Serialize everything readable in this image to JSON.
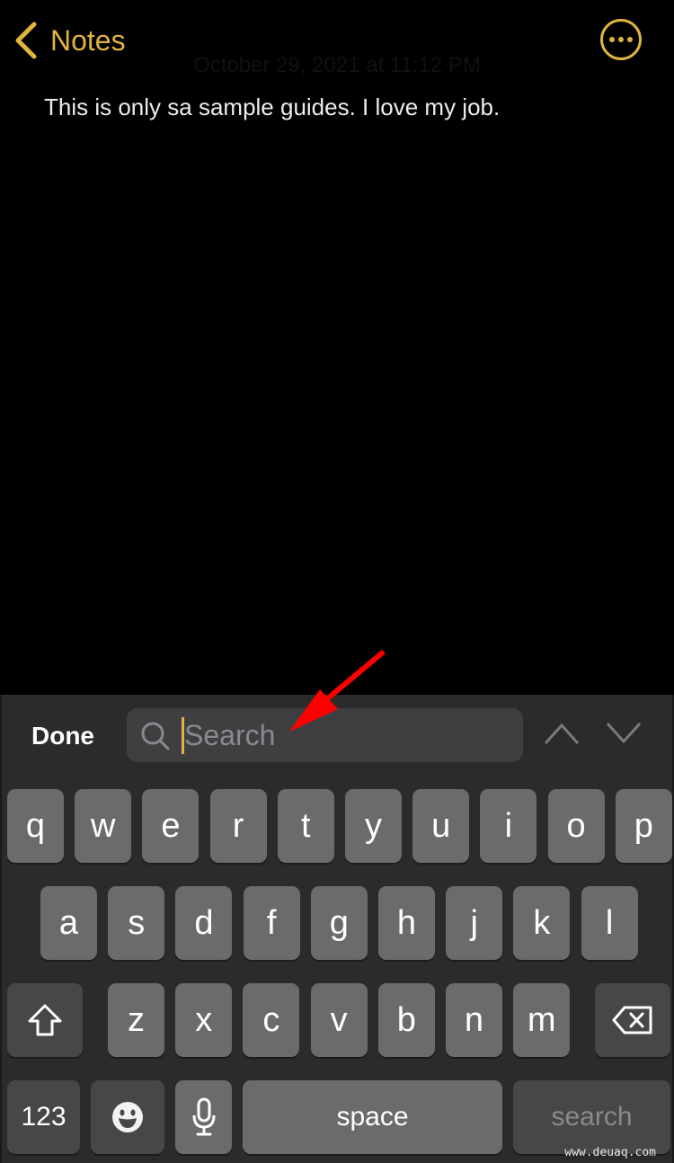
{
  "nav": {
    "back_label": "Notes",
    "back_icon": "chevron-left-icon",
    "more_icon": "ellipsis-circle-icon",
    "accent_color": "#E1B43F"
  },
  "note": {
    "date": "October 29, 2021 at 11:12 PM",
    "body": "This is only sa sample guides. I love my job."
  },
  "find_bar": {
    "done_label": "Done",
    "search_placeholder": "Search",
    "search_value": "",
    "search_icon": "magnifier-icon",
    "prev_icon": "chevron-up-icon",
    "next_icon": "chevron-down-icon"
  },
  "keyboard": {
    "row1": [
      "q",
      "w",
      "e",
      "r",
      "t",
      "y",
      "u",
      "i",
      "o",
      "p"
    ],
    "row2": [
      "a",
      "s",
      "d",
      "f",
      "g",
      "h",
      "j",
      "k",
      "l"
    ],
    "row3": [
      "z",
      "x",
      "c",
      "v",
      "b",
      "n",
      "m"
    ],
    "shift_icon": "shift-icon",
    "delete_icon": "backspace-icon",
    "numbers_label": "123",
    "emoji_icon": "emoji-icon",
    "mic_icon": "microphone-icon",
    "space_label": "space",
    "return_label": "search"
  },
  "annotation": {
    "arrow_color": "#FF0000",
    "points_to": "search-field"
  },
  "watermark": "www.deuaq.com"
}
